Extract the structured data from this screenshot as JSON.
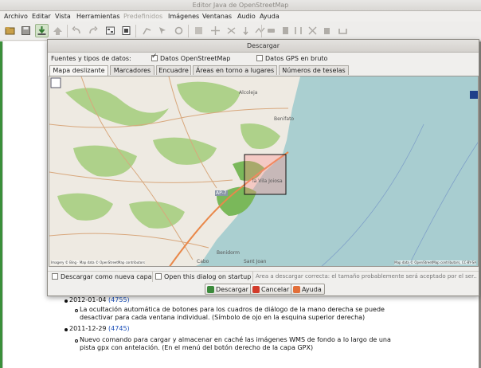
{
  "window": {
    "title": "Editor Java de OpenStreetMap"
  },
  "menu": [
    {
      "label": "Archivo",
      "enabled": true
    },
    {
      "label": "Editar",
      "enabled": true
    },
    {
      "label": "Vista",
      "enabled": true
    },
    {
      "label": "Herramientas",
      "enabled": true
    },
    {
      "label": "Predefinidos",
      "enabled": false
    },
    {
      "label": "Imágenes",
      "enabled": true
    },
    {
      "label": "Ventanas",
      "enabled": true
    },
    {
      "label": "Audio",
      "enabled": true
    },
    {
      "label": "Ayuda",
      "enabled": true
    }
  ],
  "toolbar_icons": [
    "open-file-icon",
    "save-icon",
    "download-icon",
    "upload-icon",
    "undo-icon",
    "redo-icon",
    "preferences-icon",
    "paste-icon",
    "draw-icon",
    "select-icon",
    "refresh-icon",
    "zoom-icon",
    "move-icon",
    "rotate-icon",
    "split-icon",
    "combine-icon",
    "align-icon",
    "reverse-icon",
    "delete-icon",
    "orthogonalize-icon",
    "car-icon",
    "building-icon",
    "pin-icon",
    "crossing-icon"
  ],
  "doc": {
    "entry_1_date": "2012-01-04",
    "entry_1_link": "(4755)",
    "entry_1_line1": "La ocultación automática de botones para los cuadros de diálogo de la mano derecha se puede",
    "entry_1_line2": "desactivar para cada ventana individual. (Símbolo de ojo en la esquina superior derecha)",
    "entry_2_date": "2011-12-29",
    "entry_2_link": "(4745)",
    "entry_2_line1": "Nuevo comando para cargar y almacenar en caché las imágenes WMS de fondo a lo largo de una",
    "entry_2_line2": "pista gpx con antelación. (En el menú del botón derecho de la capa GPX)"
  },
  "dialog": {
    "title": "Descargar",
    "sources_label": "Fuentes y tipos de datos:",
    "osm_checkbox_label": "Datos OpenStreetMap",
    "osm_checked": true,
    "gps_checkbox_label": "Datos GPS en bruto",
    "gps_checked": false,
    "tabs": [
      {
        "label": "Mapa deslizante",
        "active": true
      },
      {
        "label": "Marcadores",
        "active": false
      },
      {
        "label": "Encuadre",
        "active": false
      },
      {
        "label": "Áreas en torno a lugares",
        "active": false
      },
      {
        "label": "Números de teselas",
        "active": false
      }
    ],
    "map_labels": {
      "place_1": "Alcoleja",
      "place_2": "Benifato",
      "place_3": "la Vila Joiosa",
      "road": "AP-7",
      "place_4": "Benidorm",
      "place_5": "Cabo",
      "place_6": "Sant Joan",
      "attribution_left": "Imagery © Bing · Map data © OpenStreetMap contributors",
      "attribution_right": "Map data © OpenStreetMap contributors, CC-BY-SA"
    },
    "new_layer_label": "Descargar como nueva capa",
    "new_layer_checked": false,
    "startup_label": "Open this dialog on startup",
    "startup_checked": false,
    "status_text": "Área a descargar correcta: el tamaño probablemente será aceptado por el ser...",
    "btn_download": "Descargar",
    "btn_cancel": "Cancelar",
    "btn_help": "Ayuda"
  }
}
